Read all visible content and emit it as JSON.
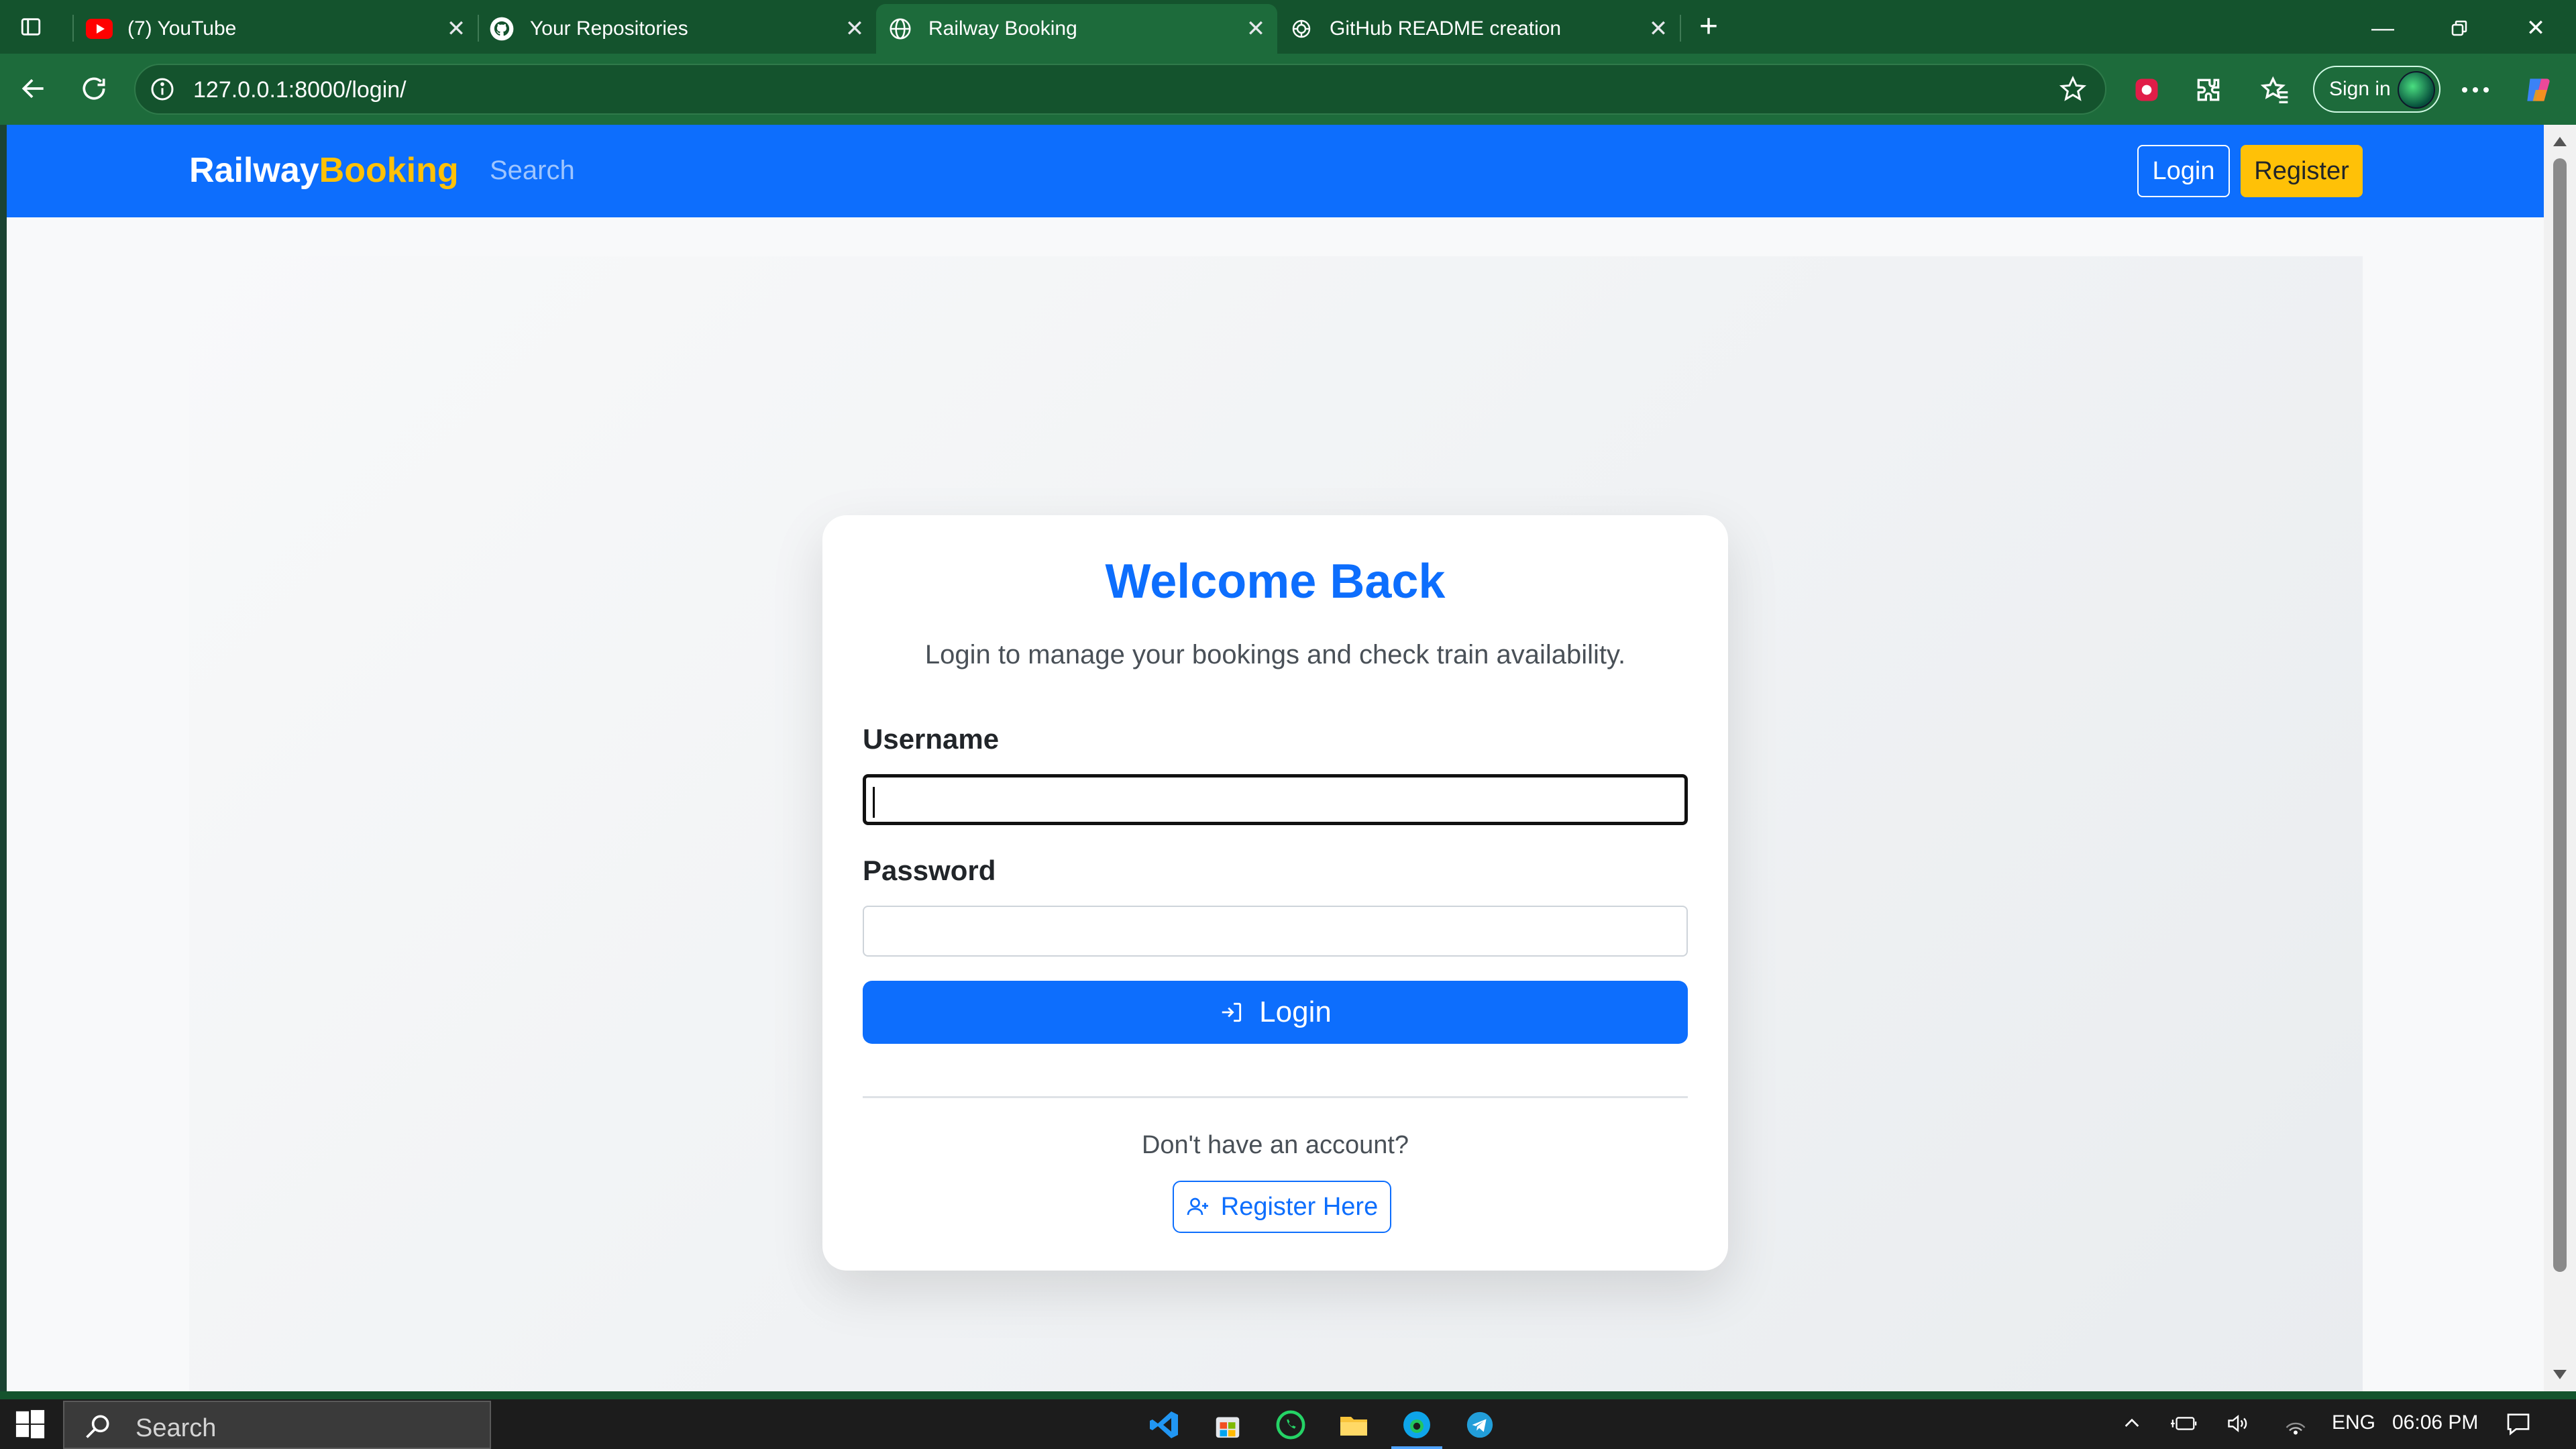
{
  "browser": {
    "tabs": [
      {
        "title": "(7) YouTube",
        "icon": "youtube-icon"
      },
      {
        "title": "Your Repositories",
        "icon": "github-icon"
      },
      {
        "title": "Railway Booking",
        "icon": "globe-icon",
        "active": true
      },
      {
        "title": "GitHub README creation",
        "icon": "openai-icon"
      }
    ],
    "url": "127.0.0.1:8000/login/",
    "sign_in_label": "Sign in"
  },
  "site": {
    "brand_main": "Railway",
    "brand_accent": "Booking",
    "nav_search": "Search",
    "nav_login": "Login",
    "nav_register": "Register"
  },
  "login_card": {
    "title": "Welcome Back",
    "subtitle": "Login to manage your bookings and check train availability.",
    "username_label": "Username",
    "username_value": "",
    "password_label": "Password",
    "password_value": "",
    "submit_label": "Login",
    "no_account_text": "Don't have an account?",
    "register_link_label": "Register Here"
  },
  "taskbar": {
    "search_label": "Search",
    "language": "ENG",
    "time": "06:06 PM"
  },
  "colors": {
    "primary": "#0d6efd",
    "accent": "#ffc107",
    "browser_frame": "#1d6b3b"
  }
}
